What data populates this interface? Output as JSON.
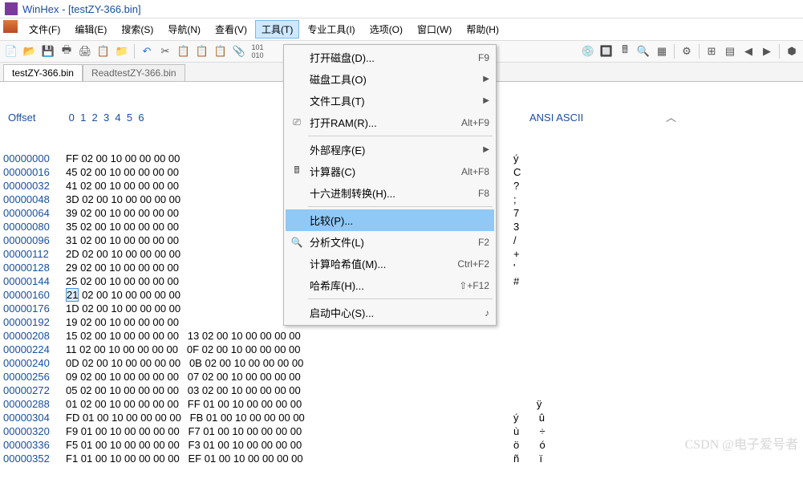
{
  "title": "WinHex - [testZY-366.bin]",
  "menus": [
    "文件(F)",
    "编辑(E)",
    "搜索(S)",
    "导航(N)",
    "查看(V)",
    "工具(T)",
    "专业工具(I)",
    "选项(O)",
    "窗口(W)",
    "帮助(H)"
  ],
  "open_menu_index": 5,
  "tabs": [
    "testZY-366.bin",
    "ReadtestZY-366.bin"
  ],
  "active_tab": 0,
  "hex_header": {
    "offset": "Offset",
    "cols": " 0  1  2  3  4  5  6  ",
    "ansi": "ANSI ASCII"
  },
  "cursor": {
    "row": 10,
    "col": 0
  },
  "rows": [
    {
      "offset": "00000000",
      "b1": "FF 02 00 10 00 00 00 00",
      "b2": "",
      "ansi": "ý"
    },
    {
      "offset": "00000016",
      "b1": "45 02 00 10 00 00 00 00",
      "b2": "",
      "ansi": "C"
    },
    {
      "offset": "00000032",
      "b1": "41 02 00 10 00 00 00 00",
      "b2": "",
      "ansi": "?"
    },
    {
      "offset": "00000048",
      "b1": "3D 02 00 10 00 00 00 00",
      "b2": "",
      "ansi": ";"
    },
    {
      "offset": "00000064",
      "b1": "39 02 00 10 00 00 00 00",
      "b2": "",
      "ansi": "7"
    },
    {
      "offset": "00000080",
      "b1": "35 02 00 10 00 00 00 00",
      "b2": "",
      "ansi": "3"
    },
    {
      "offset": "00000096",
      "b1": "31 02 00 10 00 00 00 00",
      "b2": "",
      "ansi": "/"
    },
    {
      "offset": "00000112",
      "b1": "2D 02 00 10 00 00 00 00",
      "b2": "",
      "ansi": "+"
    },
    {
      "offset": "00000128",
      "b1": "29 02 00 10 00 00 00 00",
      "b2": "",
      "ansi": "'"
    },
    {
      "offset": "00000144",
      "b1": "25 02 00 10 00 00 00 00",
      "b2": "",
      "ansi": "#"
    },
    {
      "offset": "00000160",
      "b1": "21 02 00 10 00 00 00 00",
      "b2": "",
      "ansi": ""
    },
    {
      "offset": "00000176",
      "b1": "1D 02 00 10 00 00 00 00",
      "b2": "",
      "ansi": ""
    },
    {
      "offset": "00000192",
      "b1": "19 02 00 10 00 00 00 00",
      "b2": "",
      "ansi": ""
    },
    {
      "offset": "00000208",
      "b1": "15 02 00 10 00 00 00 00",
      "b2": "13 02 00 10 00 00 00 00",
      "ansi": ""
    },
    {
      "offset": "00000224",
      "b1": "11 02 00 10 00 00 00 00",
      "b2": "0F 02 00 10 00 00 00 00",
      "ansi": ""
    },
    {
      "offset": "00000240",
      "b1": "0D 02 00 10 00 00 00 00",
      "b2": "0B 02 00 10 00 00 00 00",
      "ansi": ""
    },
    {
      "offset": "00000256",
      "b1": "09 02 00 10 00 00 00 00",
      "b2": "07 02 00 10 00 00 00 00",
      "ansi": ""
    },
    {
      "offset": "00000272",
      "b1": "05 02 00 10 00 00 00 00",
      "b2": "03 02 00 10 00 00 00 00",
      "ansi": ""
    },
    {
      "offset": "00000288",
      "b1": "01 02 00 10 00 00 00 00",
      "b2": "FF 01 00 10 00 00 00 00",
      "ansi": "        ÿ"
    },
    {
      "offset": "00000304",
      "b1": "FD 01 00 10 00 00 00 00",
      "b2": "FB 01 00 10 00 00 00 00",
      "ansi": "ý       û"
    },
    {
      "offset": "00000320",
      "b1": "F9 01 00 10 00 00 00 00",
      "b2": "F7 01 00 10 00 00 00 00",
      "ansi": "ù       ÷"
    },
    {
      "offset": "00000336",
      "b1": "F5 01 00 10 00 00 00 00",
      "b2": "F3 01 00 10 00 00 00 00",
      "ansi": "ö       ó"
    },
    {
      "offset": "00000352",
      "b1": "F1 01 00 10 00 00 00 00",
      "b2": "EF 01 00 10 00 00 00 00",
      "ansi": "ñ       ï"
    }
  ],
  "dropdown": [
    {
      "type": "item",
      "icon": "",
      "label": "打开磁盘(D)...",
      "accel": "F9"
    },
    {
      "type": "item",
      "icon": "",
      "label": "磁盘工具(O)",
      "arrow": true
    },
    {
      "type": "item",
      "icon": "",
      "label": "文件工具(T)",
      "arrow": true
    },
    {
      "type": "item",
      "icon": "ram",
      "label": "打开RAM(R)...",
      "accel": "Alt+F9"
    },
    {
      "type": "sep"
    },
    {
      "type": "item",
      "icon": "",
      "label": "外部程序(E)",
      "arrow": true
    },
    {
      "type": "item",
      "icon": "calc",
      "label": "计算器(C)",
      "accel": "Alt+F8"
    },
    {
      "type": "item",
      "icon": "",
      "label": "十六进制转换(H)...",
      "accel": "F8"
    },
    {
      "type": "sep"
    },
    {
      "type": "item",
      "icon": "",
      "label": "比较(P)...",
      "highlight": true
    },
    {
      "type": "item",
      "icon": "search",
      "label": "分析文件(L)",
      "accel": "F2"
    },
    {
      "type": "item",
      "icon": "",
      "label": "计算哈希值(M)...",
      "accel": "Ctrl+F2"
    },
    {
      "type": "item",
      "icon": "",
      "label": "哈希库(H)...",
      "accel": "⇧+F12"
    },
    {
      "type": "sep"
    },
    {
      "type": "item",
      "icon": "",
      "label": "启动中心(S)...",
      "accel": "♪"
    }
  ],
  "watermark": "CSDN @电子爱号者"
}
